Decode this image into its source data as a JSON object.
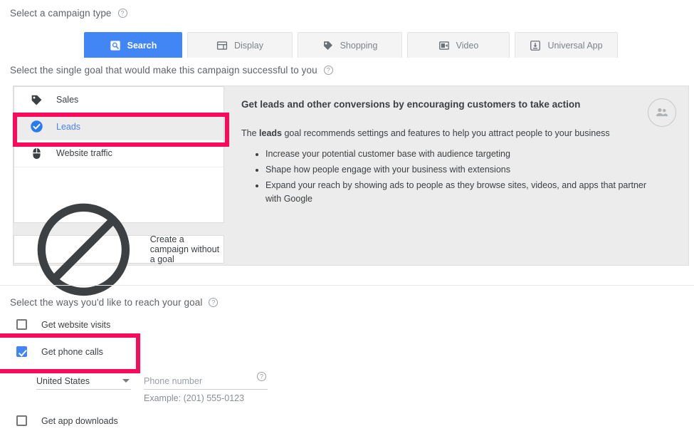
{
  "campaign_type": {
    "label": "Select a campaign type",
    "help_icon": "help-icon",
    "tabs": [
      {
        "label": "Search",
        "icon": "search-icon",
        "selected": true
      },
      {
        "label": "Display",
        "icon": "display-icon",
        "selected": false
      },
      {
        "label": "Shopping",
        "icon": "shopping-tag-icon",
        "selected": false
      },
      {
        "label": "Video",
        "icon": "video-camera-icon",
        "selected": false
      },
      {
        "label": "Universal App",
        "icon": "app-download-icon",
        "selected": false
      }
    ]
  },
  "goal_section": {
    "label": "Select the single goal that would make this campaign successful to you",
    "help_icon": "help-icon",
    "goals": [
      {
        "label": "Sales",
        "icon": "tag-icon",
        "selected": false
      },
      {
        "label": "Leads",
        "icon": "check-circle-icon",
        "selected": true
      },
      {
        "label": "Website traffic",
        "icon": "mouse-icon",
        "selected": false
      }
    ],
    "no_goal": {
      "label": "Create a campaign without a goal",
      "icon": "no-entry-icon"
    },
    "detail": {
      "avatar_icon": "people-group-icon",
      "heading": "Get leads and other conversions by encouraging customers to take action",
      "subtext_prefix": "The ",
      "subtext_bold": "leads",
      "subtext_suffix": " goal recommends settings and features to help you attract people to your business",
      "bullets": [
        "Increase your potential customer base with audience targeting",
        "Shape how people engage with your business with extensions",
        "Expand your reach by showing ads to people as they browse sites, videos, and apps that partner with Google"
      ]
    }
  },
  "ways_section": {
    "label": "Select the ways you'd like to reach your goal",
    "help_icon": "help-icon",
    "options": [
      {
        "label": "Get website visits",
        "checked": false
      },
      {
        "label": "Get phone calls",
        "checked": true
      },
      {
        "label": "Get app downloads",
        "checked": false
      }
    ],
    "phone": {
      "country_value": "United States",
      "country_caret_icon": "chevron-down-icon",
      "number_placeholder": "Phone number",
      "number_value": "",
      "help_icon": "help-icon",
      "example": "Example: (201) 555-0123"
    }
  },
  "annotations": {
    "color": "#fa0a5a",
    "boxes": [
      "leads-goal-highlight",
      "get-phone-calls-highlight"
    ]
  }
}
